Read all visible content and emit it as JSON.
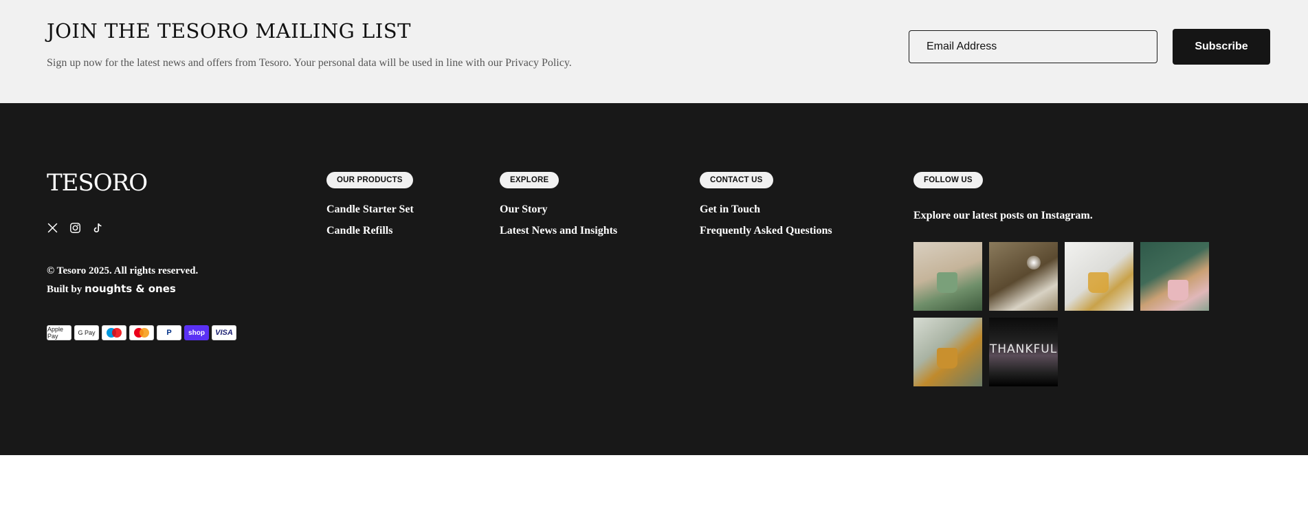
{
  "mailing": {
    "title": "JOIN THE TESORO MAILING LIST",
    "description": "Sign up now for the latest news and offers from Tesoro. Your personal data will be used in line with our Privacy Policy.",
    "email_placeholder": "Email Address",
    "subscribe_label": "Subscribe"
  },
  "footer": {
    "logo": "TESORO",
    "social_icons": [
      "x-icon",
      "instagram-icon",
      "tiktok-icon"
    ],
    "copyright": "© Tesoro 2025. All rights reserved.",
    "built_by_prefix": "Built by",
    "built_by_brand": "noughts & ones",
    "payments": [
      "Apple Pay",
      "G Pay",
      "Maestro",
      "Mastercard",
      "PayPal",
      "shop",
      "VISA"
    ],
    "columns": [
      {
        "heading": "OUR PRODUCTS",
        "links": [
          "Candle Starter Set",
          "Candle Refills"
        ]
      },
      {
        "heading": "EXPLORE",
        "links": [
          "Our Story",
          "Latest News and Insights"
        ]
      },
      {
        "heading": "CONTACT US",
        "links": [
          "Get in Touch",
          "Frequently Asked Questions"
        ]
      }
    ],
    "follow": {
      "heading": "FOLLOW US",
      "text": "Explore our latest posts on Instagram.",
      "thumb_caption": "THANKFUL"
    }
  },
  "colors": {
    "mailing_bg": "#f1f1f1",
    "footer_bg": "#181818",
    "button_bg": "#151515",
    "pill_bg": "#f1f1f1",
    "shop_pay": "#5a31f4"
  }
}
